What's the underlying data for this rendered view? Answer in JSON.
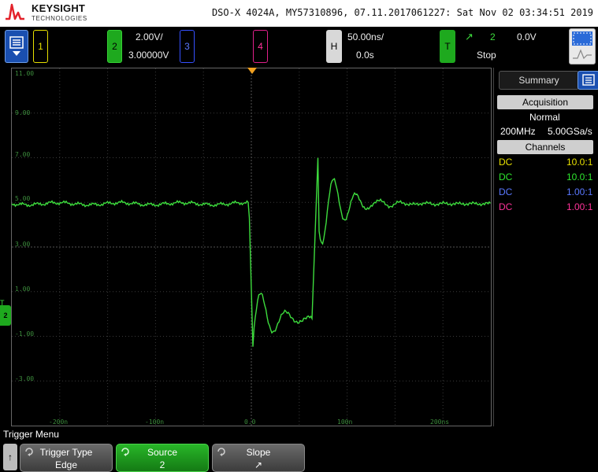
{
  "header": {
    "brand": "KEYSIGHT",
    "brand_sub": "TECHNOLOGIES",
    "device_info": "DSO-X 4024A, MY57310896, 07.11.2017061227: Sat Nov 02 03:34:51 2019"
  },
  "channels": {
    "ch1_label": "1",
    "ch2_label": "2",
    "ch2_scale": "2.00V/",
    "ch2_offset": "3.00000V",
    "ch3_label": "3",
    "ch4_label": "4"
  },
  "horizontal": {
    "label": "H",
    "timebase": "50.00ns/",
    "delay": "0.0s"
  },
  "trigger": {
    "label": "T",
    "slope_symbol": "↗",
    "source": "2",
    "level": "0.0V",
    "state": "Stop"
  },
  "graticule": {
    "volt_labels": [
      "11.00",
      "9.00",
      "7.00",
      "5.00",
      "3.00",
      "1.00",
      "-1.00",
      "-3.00"
    ],
    "time_labels": [
      "-200n",
      "-100n",
      "0.0",
      "100n",
      "200ns"
    ],
    "ground_marker": "2",
    "trigger_marker": "T"
  },
  "side_panel": {
    "tab_label": "Summary",
    "acquisition_header": "Acquisition",
    "acq_mode": "Normal",
    "bandwidth": "200MHz",
    "sample_rate": "5.00GSa/s",
    "channels_header": "Channels",
    "channel_rows": [
      {
        "coupling": "DC",
        "probe": "10.0:1",
        "color": "#e8e000"
      },
      {
        "coupling": "DC",
        "probe": "10.0:1",
        "color": "#2ee62e"
      },
      {
        "coupling": "DC",
        "probe": "1.00:1",
        "color": "#5a78ff"
      },
      {
        "coupling": "DC",
        "probe": "1.00:1",
        "color": "#ff3399"
      }
    ]
  },
  "softkeys": {
    "menu_title": "Trigger Menu",
    "back_symbol": "↑",
    "trigger_type_label": "Trigger Type",
    "trigger_type_value": "Edge",
    "source_label": "Source",
    "source_value": "2",
    "slope_label": "Slope",
    "slope_value": "↗"
  },
  "colors": {
    "trace": "#3ddc3d",
    "grid": "#3a3a3a",
    "accent_blue": "#1a4fb0"
  }
}
